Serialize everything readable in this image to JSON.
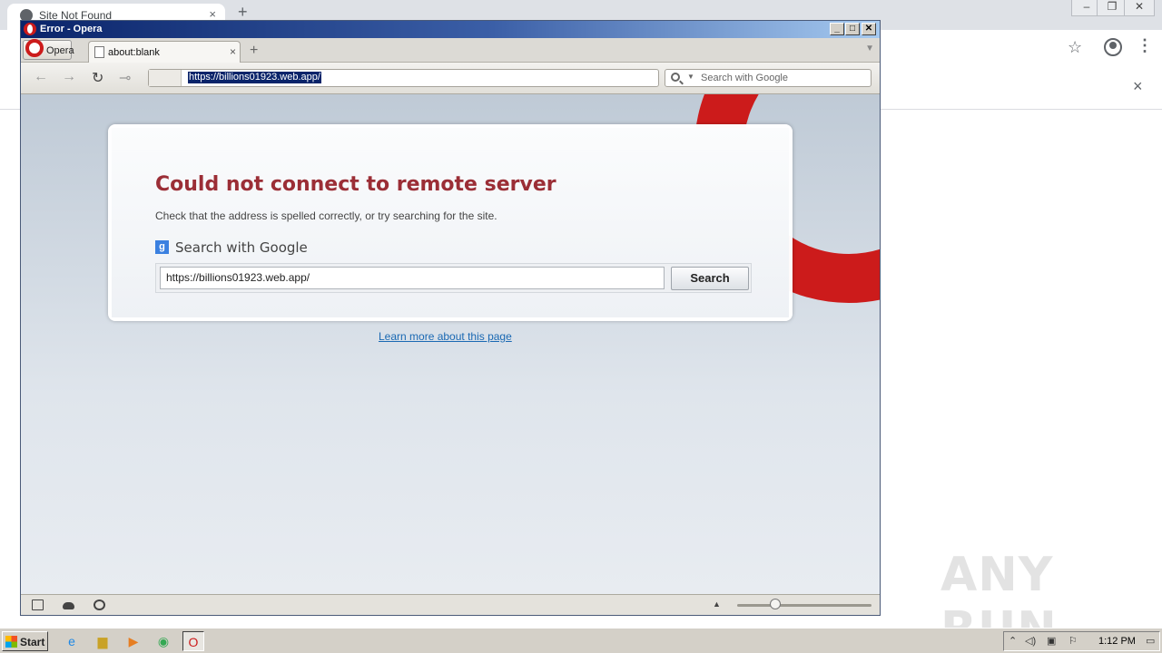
{
  "chrome": {
    "tab_title": "Site Not Found",
    "new_tab_label": "+",
    "close_label": "×",
    "min_label": "–",
    "restore_label": "❐",
    "winclose_label": "✕",
    "menu_label": "⋮",
    "star_label": "☆"
  },
  "watermark": "ANY RUN",
  "opera": {
    "window_title": "Error - Opera",
    "menu_label": "Opera",
    "tab_title": "about:blank",
    "tab_close": "×",
    "new_tab": "+",
    "tabbar_menu": "▼",
    "address": "https://billions01923.web.app/",
    "search_placeholder": "Search with Google",
    "nav": {
      "back": "←",
      "forward": "→",
      "reload": "↻",
      "key": "⊸"
    },
    "titlebar_buttons": {
      "min": "_",
      "max": "□",
      "close": "✕"
    }
  },
  "error_page": {
    "title": "Could not connect to remote server",
    "message": "Check that the address is spelled correctly, or try searching for the site.",
    "google_icon": "g",
    "search_label": "Search with Google",
    "search_value": "https://billions01923.web.app/",
    "search_button": "Search",
    "learn_more": "Learn more about this page"
  },
  "statusbar": {
    "up_label": "▲"
  },
  "taskbar": {
    "start_label": "Start",
    "apps": [
      "ie-icon",
      "folder-icon",
      "media-player-icon",
      "chrome-icon",
      "opera-icon"
    ],
    "clock": "1:12 PM"
  }
}
